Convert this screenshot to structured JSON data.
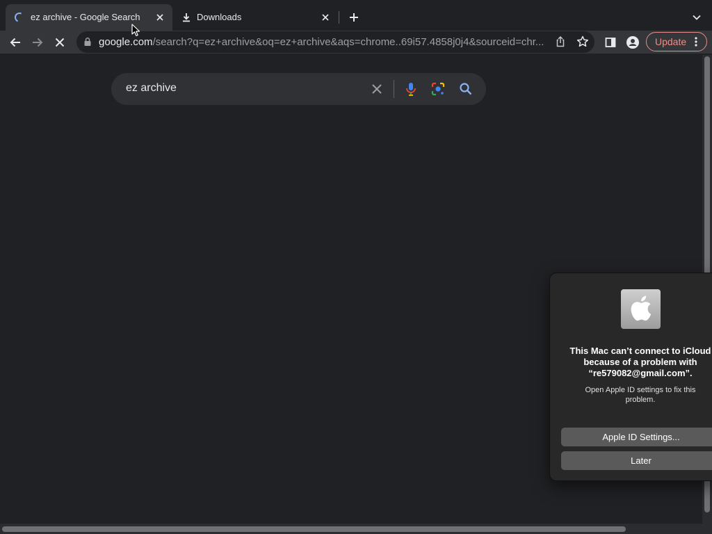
{
  "browser": {
    "tabs": [
      {
        "title": "ez archive - Google Search",
        "active": true,
        "icon": "loading-spinner-icon"
      },
      {
        "title": "Downloads",
        "active": false,
        "icon": "download-icon"
      }
    ],
    "address_bar": {
      "host": "google.com",
      "path": "/search?q=ez+archive&oq=ez+archive&aqs=chrome..69i57.4858j0j4&sourceid=chr..."
    },
    "update_label": "Update"
  },
  "search": {
    "query": "ez archive"
  },
  "dialog": {
    "icon": "apple-logo-icon",
    "title_lines": [
      "This Mac can’t connect to iCloud",
      "because of a problem with",
      "“re579082@gmail.com”."
    ],
    "message": "Open Apple ID settings to fix this problem.",
    "primary_button": "Apple ID Settings...",
    "secondary_button": "Later"
  },
  "colors": {
    "page_bg": "#202124",
    "toolbar_bg": "#35363a",
    "update_accent": "#f28b82",
    "dialog_bg": "#282828"
  }
}
